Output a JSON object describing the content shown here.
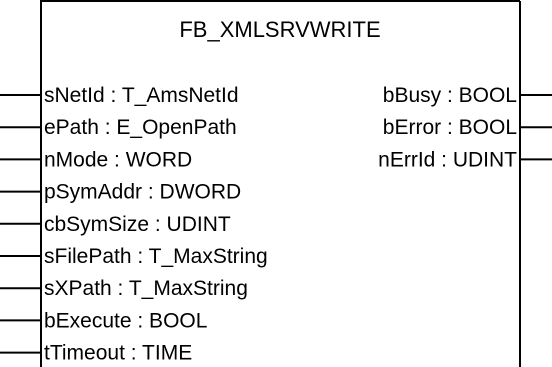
{
  "block": {
    "title": "FB_XMLSRVWRITE"
  },
  "inputs": [
    {
      "name": "sNetId",
      "type": "T_AmsNetId"
    },
    {
      "name": "ePath",
      "type": "E_OpenPath"
    },
    {
      "name": "nMode",
      "type": "WORD"
    },
    {
      "name": "pSymAddr",
      "type": "DWORD"
    },
    {
      "name": "cbSymSize",
      "type": "UDINT"
    },
    {
      "name": "sFilePath",
      "type": "T_MaxString"
    },
    {
      "name": "sXPath",
      "type": "T_MaxString"
    },
    {
      "name": "bExecute",
      "type": "BOOL"
    },
    {
      "name": "tTimeout",
      "type": "TIME"
    }
  ],
  "outputs": [
    {
      "name": "bBusy",
      "type": "BOOL"
    },
    {
      "name": "bError",
      "type": "BOOL"
    },
    {
      "name": "nErrId",
      "type": "UDINT"
    }
  ],
  "colors": {
    "line": "#000000",
    "text": "#000000",
    "background": "#ffffff"
  }
}
